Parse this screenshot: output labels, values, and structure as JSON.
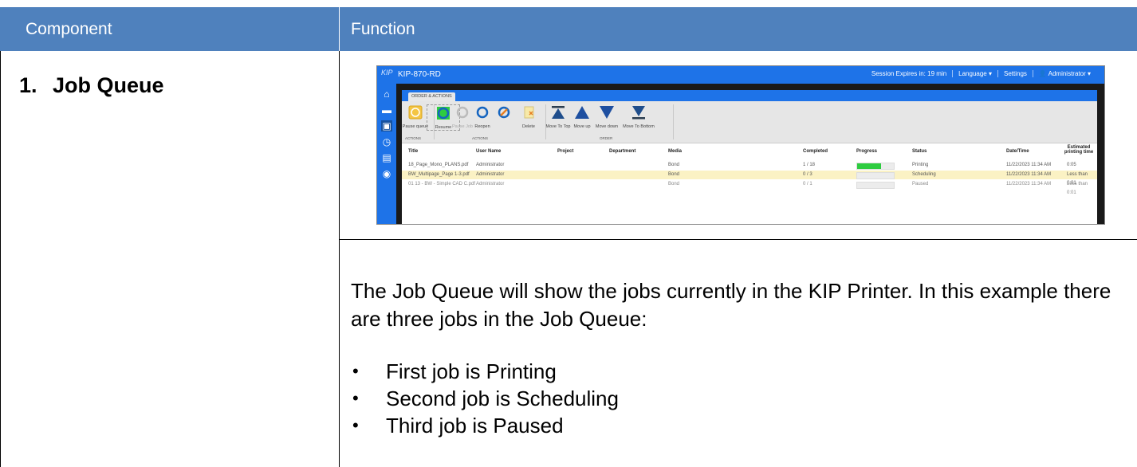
{
  "table": {
    "header": {
      "component": "Component",
      "function": "Function"
    },
    "row": {
      "number": "1.",
      "title": "Job Queue",
      "description": "The Job Queue will show the jobs currently in the KIP Printer. In this example there are three jobs in the Job Queue:",
      "bullets": [
        "First job is Printing",
        "Second job is Scheduling",
        "Third job is Paused"
      ]
    }
  },
  "screenshot": {
    "logo": "KIP",
    "app_title": "KIP-870-RD",
    "topbar": {
      "session": "Session Expires in: 19 min",
      "language": "Language ▾",
      "settings": "Settings",
      "user": "👤 Administrator ▾"
    },
    "tab_label": "ORDER & ACTIONS",
    "ribbon": {
      "pause_queue": "Pause queue",
      "resume": "Resume",
      "pause_job": "Pause Job",
      "reopen": "Reopen",
      "delete": "Delete",
      "move_to_top": "Move To Top",
      "move_up": "Move up",
      "move_down": "Move down",
      "move_to_bottom": "Move To Bottom",
      "group_actions_1": "ACTIONS",
      "group_actions_2": "ACTIONS",
      "group_order": "ORDER"
    },
    "columns": {
      "title": "Title",
      "user_name": "User Name",
      "project": "Project",
      "department": "Department",
      "media": "Media",
      "completed": "Completed",
      "progress": "Progress",
      "status": "Status",
      "datetime": "Date/Time",
      "est_time": "Estimated printing time"
    },
    "rows": [
      {
        "title": "18_Page_Mono_PLANS.pdf",
        "user": "Administrator",
        "media": "Bond",
        "completed": "1 / 18",
        "progress": 0.65,
        "status": "Printing",
        "datetime": "11/22/2023 11:34 AM",
        "est": "0:05"
      },
      {
        "title": "BW_Multipage_Page 1-3.pdf",
        "user": "Administrator",
        "media": "Bond",
        "completed": "0 / 3",
        "progress": 0,
        "status": "Scheduling",
        "datetime": "11/22/2023 11:34 AM",
        "est": "Less than 0:01"
      },
      {
        "title": "01 13 - BW - Simple CAD C.pdf",
        "user": "Administrator",
        "media": "Bond",
        "completed": "0 / 1",
        "progress": 0,
        "status": "Paused",
        "datetime": "11/22/2023 11:34 AM",
        "est": "Less than 0:01"
      }
    ]
  }
}
